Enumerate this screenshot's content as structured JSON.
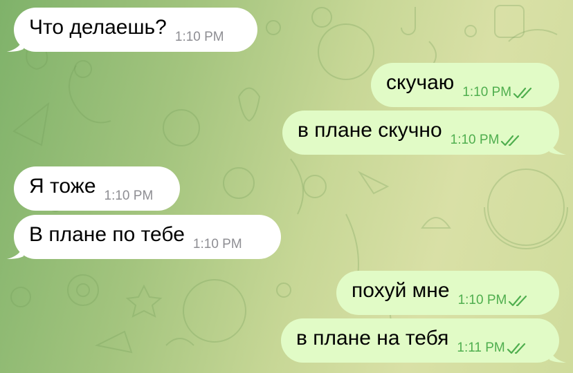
{
  "chat": {
    "messages": [
      {
        "direction": "incoming",
        "text": "Что делаешь?",
        "time": "1:10 PM"
      },
      {
        "direction": "outgoing",
        "text": "скучаю",
        "time": "1:10 PM",
        "status": "read-double-check"
      },
      {
        "direction": "outgoing",
        "text": "в плане скучно",
        "time": "1:10 PM",
        "status": "read-double-check"
      },
      {
        "direction": "incoming",
        "text": "Я тоже",
        "time": "1:10 PM"
      },
      {
        "direction": "incoming",
        "text": "В плане по тебе",
        "time": "1:10 PM"
      },
      {
        "direction": "outgoing",
        "text": "похуй мне",
        "time": "1:10 PM",
        "status": "read-double-check"
      },
      {
        "direction": "outgoing",
        "text": "в плане на тебя",
        "time": "1:11 PM",
        "status": "read-double-check"
      }
    ]
  },
  "colors": {
    "incoming_bubble": "#ffffff",
    "outgoing_bubble": "#e1fbc6",
    "outgoing_time": "#4fae4e",
    "incoming_time": "#8e8e93",
    "wallpaper_left": "#7fb26a",
    "wallpaper_right": "#d9e0a6"
  },
  "icons": {
    "read_status": "double-check-icon",
    "wallpaper": "doodle-pattern"
  }
}
